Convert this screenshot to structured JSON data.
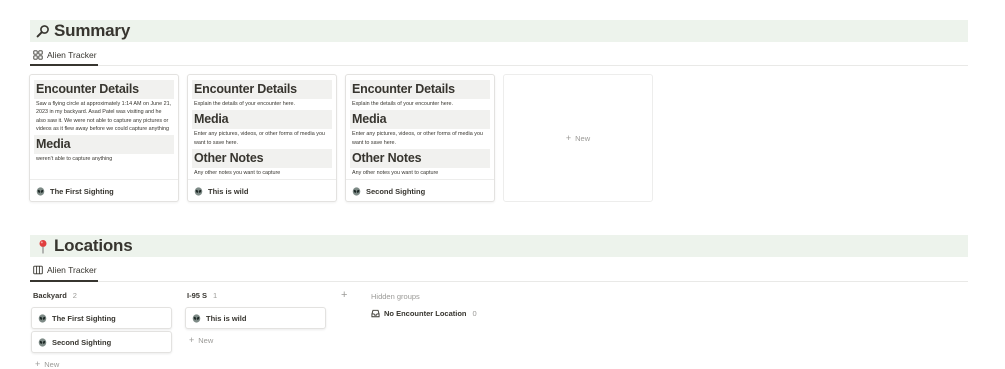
{
  "summary": {
    "title": "Summary",
    "icon": "magnifier-icon",
    "view_tab": "Alien Tracker",
    "view_icon": "gallery-icon",
    "cards": [
      {
        "sections": [
          {
            "heading": "Encounter Details",
            "text": "Saw a flying circle at approximately 1:14 AM on June 21, 2023 in my backyard. Asad Patel was visiting and he also saw it. We were not able to capture any pictures or videos as it flew away before we could capture anything"
          },
          {
            "heading": "Media",
            "text": "weren't able to capture anything"
          }
        ],
        "title": "The First Sighting"
      },
      {
        "sections": [
          {
            "heading": "Encounter Details",
            "text": "Explain the details of your encounter here."
          },
          {
            "heading": "Media",
            "text": "Enter any pictures, videos, or other forms of media you want to save here."
          },
          {
            "heading": "Other Notes",
            "text": "Any other notes you want to capture"
          }
        ],
        "title": "This is wild"
      },
      {
        "sections": [
          {
            "heading": "Encounter Details",
            "text": "Explain the details of your encounter here."
          },
          {
            "heading": "Media",
            "text": "Enter any pictures, videos, or other forms of media you want to save here."
          },
          {
            "heading": "Other Notes",
            "text": "Any other notes you want to capture"
          }
        ],
        "title": "Second Sighting"
      }
    ],
    "new_label": "New"
  },
  "locations": {
    "title": "Locations",
    "icon": "pushpin-icon",
    "view_tab": "Alien Tracker",
    "view_icon": "board-icon",
    "columns": [
      {
        "name": "Backyard",
        "count": "2",
        "cards": [
          "The First Sighting",
          "Second Sighting"
        ],
        "new_label": "New"
      },
      {
        "name": "I-95 S",
        "count": "1",
        "cards": [
          "This is wild"
        ],
        "new_label": "New"
      }
    ],
    "add_group": "+",
    "hidden_groups_label": "Hidden groups",
    "hidden_groups": [
      {
        "name": "No Encounter Location",
        "count": "0"
      }
    ]
  },
  "colors": {
    "header_bg": "#edf3ec",
    "text": "#37352f",
    "muted": "#9b9a97"
  }
}
